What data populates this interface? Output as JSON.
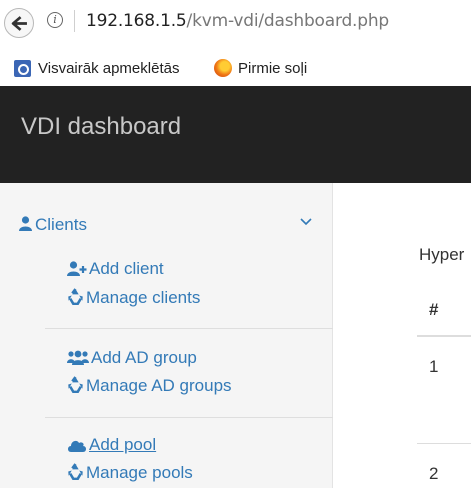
{
  "browser": {
    "url_host": "192.168.1.5",
    "url_path": "/kvm-vdi/dashboard.php",
    "bookmarks": [
      {
        "label": "Visvairāk apmeklētās",
        "icon": "bookmark-folder-icon"
      },
      {
        "label": "Pirmie soļi",
        "icon": "firefox-icon"
      }
    ]
  },
  "navbar": {
    "brand": "VDI dashboard"
  },
  "sidebar": {
    "section_title": "Clients",
    "groups": [
      [
        {
          "label": "Add client",
          "icon": "user-plus-icon"
        },
        {
          "label": "Manage clients",
          "icon": "recycle-icon"
        }
      ],
      [
        {
          "label": "Add AD group",
          "icon": "users-icon"
        },
        {
          "label": "Manage AD groups",
          "icon": "recycle-icon"
        }
      ],
      [
        {
          "label": "Add pool",
          "icon": "cloud-icon"
        },
        {
          "label": "Manage pools",
          "icon": "recycle-icon"
        }
      ]
    ]
  },
  "main": {
    "heading_partial": "Hyper",
    "table": {
      "header": "#",
      "rows": [
        "1",
        "2"
      ]
    }
  },
  "colors": {
    "link": "#337ab7",
    "navbar": "#222222",
    "sidebar_bg": "#f5f5f5"
  }
}
